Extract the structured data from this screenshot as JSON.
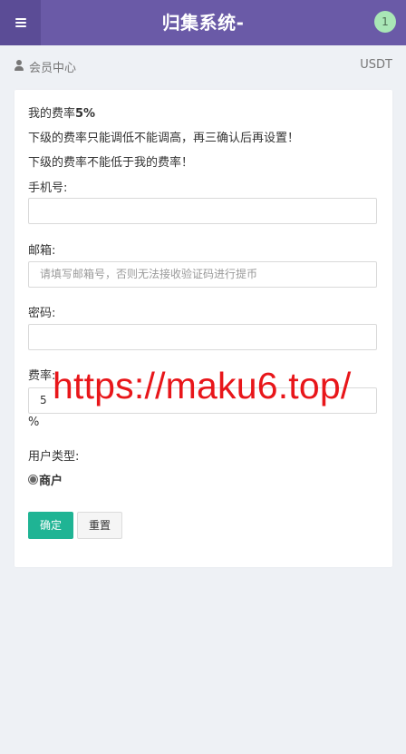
{
  "header": {
    "menu_icon": "hamburger-menu-icon",
    "title": "归集系统-",
    "notification_count": "1"
  },
  "breadcrumb": {
    "icon": "user-icon",
    "label": "会员中心",
    "right": "USDT"
  },
  "form": {
    "rate_line_label": "我的费率",
    "rate_line_value": "5%",
    "notice_1": "下级的费率只能调低不能调高，再三确认后再设置！",
    "notice_2": "下级的费率不能低于我的费率！",
    "phone": {
      "label": "手机号:",
      "value": "",
      "placeholder": ""
    },
    "email": {
      "label": "邮箱:",
      "value": "",
      "placeholder": "请填写邮箱号，否则无法接收验证码进行提币"
    },
    "password": {
      "label": "密码:",
      "value": "",
      "placeholder": ""
    },
    "rate": {
      "label": "费率:",
      "value": "5",
      "unit": "%"
    },
    "user_type": {
      "label": "用户类型:",
      "options": [
        {
          "label": "商户",
          "selected": true
        }
      ]
    },
    "buttons": {
      "confirm": "确定",
      "reset": "重置"
    }
  },
  "watermark": "https://maku6.top/",
  "colors": {
    "header_bg": "#6a5aa7",
    "menu_button_bg": "#5b4c96",
    "badge_bg": "#a9e6b6",
    "confirm_button": "#1fb494",
    "watermark": "#e8161a",
    "page_bg": "#eef1f5"
  }
}
